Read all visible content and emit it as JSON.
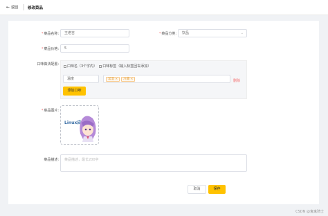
{
  "header": {
    "back_label": "返回",
    "title": "修改菜品"
  },
  "form": {
    "name": {
      "label": "菜品名称:",
      "value": "王老吉"
    },
    "category": {
      "label": "菜品分类:",
      "value": "饮品"
    },
    "price": {
      "label": "菜品价格:",
      "value": "5"
    },
    "flavor": {
      "label": "口味做法配置:",
      "option_a": "口味名（3个字内）",
      "option_b": "口味标签（输入标签回车添加）",
      "name_value": "温度",
      "tags": [
        "常温",
        "冷藏"
      ],
      "delete_label": "删除",
      "add_button": "添加口味"
    },
    "image": {
      "label": "菜品图片:",
      "pic_text": "Linux应用"
    },
    "description": {
      "label": "菜品描述:",
      "placeholder": "菜品描述，最长200字"
    }
  },
  "actions": {
    "cancel_label": "取消",
    "save_label": "保存"
  },
  "footer": {
    "watermark": "CSDN @鬼鬼骑士"
  },
  "colors": {
    "accent": "#ffc200",
    "required": "#f56c6c",
    "tag_text": "#e6a23c"
  }
}
